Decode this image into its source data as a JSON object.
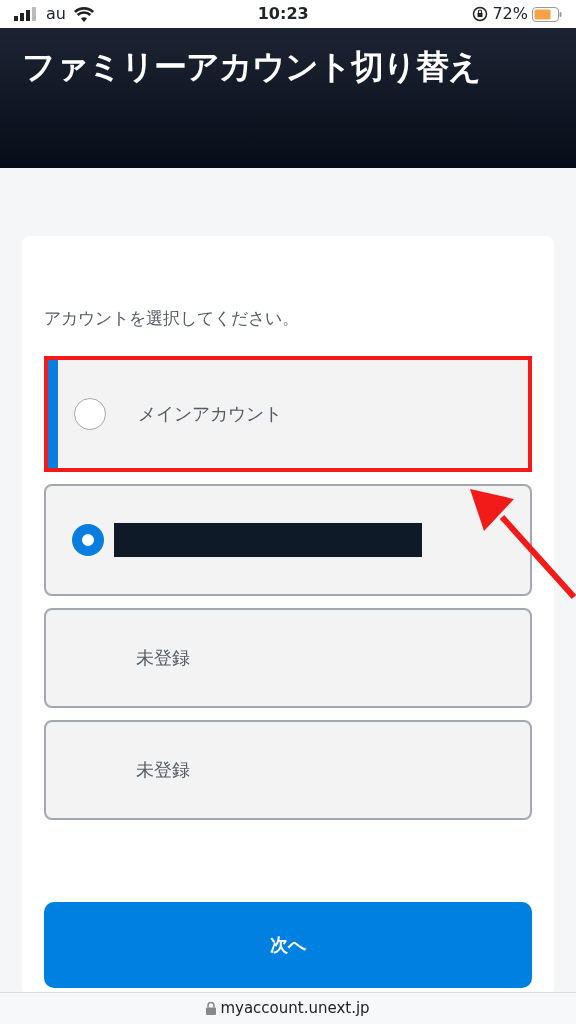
{
  "status_bar": {
    "carrier": "au",
    "time": "10:23",
    "battery": "72%"
  },
  "header": {
    "title": "ファミリーアカウント切り替え"
  },
  "prompt": "アカウントを選択してください。",
  "options": [
    {
      "kind": "radio",
      "label": "メインアカウント",
      "selected": false,
      "highlighted": true
    },
    {
      "kind": "redacted",
      "selected": true,
      "highlighted": false
    },
    {
      "kind": "plain",
      "label": "未登録",
      "highlighted": false
    },
    {
      "kind": "plain",
      "label": "未登録",
      "highlighted": false
    }
  ],
  "next_button": "次へ",
  "url_bar": {
    "address": "myaccount.unext.jp"
  }
}
